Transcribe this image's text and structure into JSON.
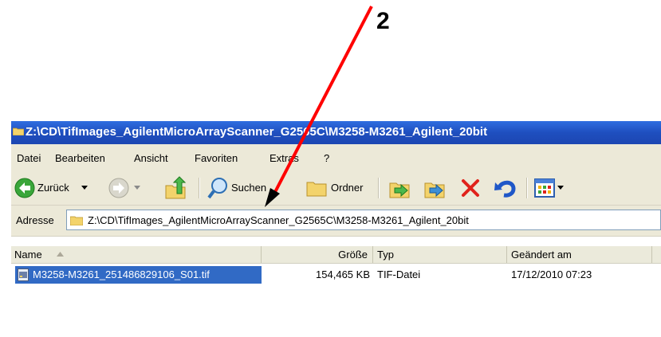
{
  "annotation": {
    "number": "2"
  },
  "window": {
    "title": "Z:\\CD\\TifImages_AgilentMicroArrayScanner_G2565C\\M3258-M3261_Agilent_20bit"
  },
  "menu": [
    "Datei",
    "Bearbeiten",
    "Ansicht",
    "Favoriten",
    "Extras",
    "?"
  ],
  "toolbar": {
    "back_label": "Zurück",
    "search_label": "Suchen",
    "folders_label": "Ordner"
  },
  "address": {
    "label": "Adresse",
    "value": "Z:\\CD\\TifImages_AgilentMicroArrayScanner_G2565C\\M3258-M3261_Agilent_20bit"
  },
  "columns": [
    "Name",
    "Größe",
    "Typ",
    "Geändert am"
  ],
  "files": [
    {
      "name": "M3258-M3261_251486829106_S01.tif",
      "size": "154,465 KB",
      "type": "TIF-Datei",
      "modified": "17/12/2010 07:23",
      "selected": true
    }
  ],
  "colors": {
    "title_bar": "#1f4fbf",
    "selection": "#316ac5",
    "annotation_arrow": "#ff0000"
  }
}
